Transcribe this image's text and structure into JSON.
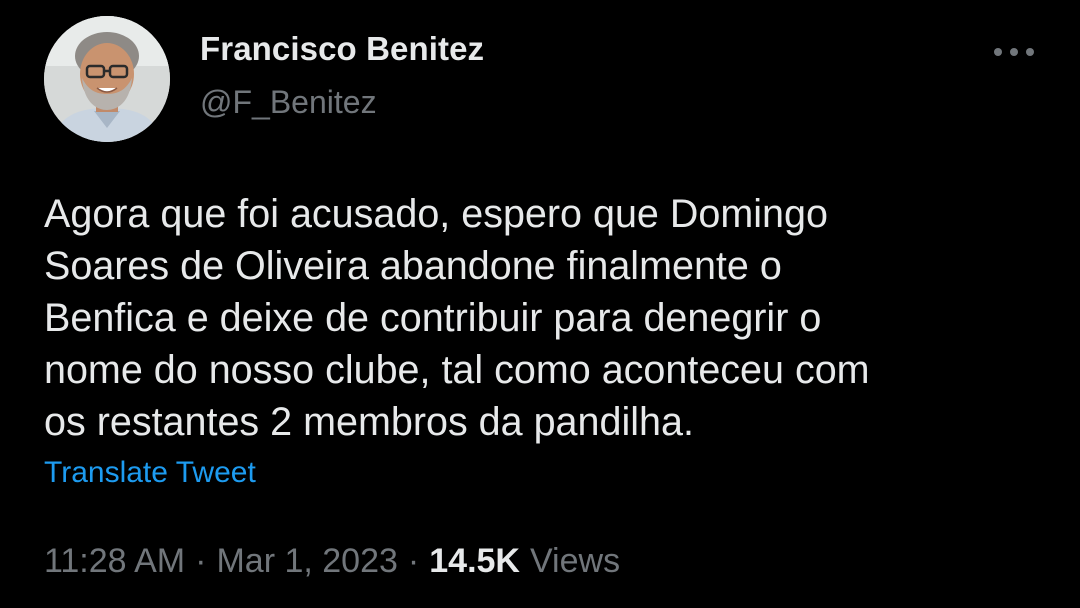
{
  "author": {
    "name": "Francisco Benitez",
    "handle": "@F_Benitez",
    "avatar_icon": "profile-photo"
  },
  "more_icon": "more-horizontal-icon",
  "tweet": {
    "lines": [
      "Agora que foi acusado, espero que Domingo",
      "Soares de Oliveira abandone finalmente o",
      "Benfica e deixe de contribuir para denegrir o",
      "nome do nosso clube, tal como aconteceu com",
      "os restantes 2 membros da pandilha."
    ],
    "translate_label": "Translate Tweet"
  },
  "meta": {
    "time": "11:28 AM",
    "separator": "·",
    "date": "Mar 1, 2023",
    "views_count": "14.5K",
    "views_label": "Views"
  },
  "colors": {
    "background": "#000000",
    "primary_text": "#e7e9ea",
    "secondary_text": "#71767b",
    "link": "#1d9bf0"
  }
}
